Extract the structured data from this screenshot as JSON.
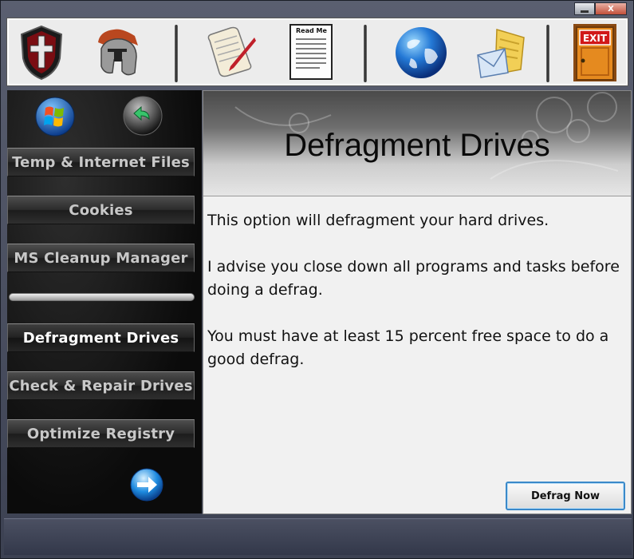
{
  "window": {
    "caption_buttons": {
      "minimize": "",
      "close": "X"
    }
  },
  "toolbar": {
    "icons": [
      {
        "name": "shield-cross-icon"
      },
      {
        "name": "spartan-helmet-icon"
      },
      {
        "name": "scroll-quill-icon"
      },
      {
        "name": "readme-document-icon",
        "label": "Read Me"
      },
      {
        "name": "globe-icon"
      },
      {
        "name": "mail-envelope-icon"
      },
      {
        "name": "exit-door-icon",
        "label": "EXIT"
      }
    ]
  },
  "sidebar": {
    "nav": [
      {
        "label": "Temp & Internet Files",
        "active": false
      },
      {
        "label": "Cookies",
        "active": false
      },
      {
        "label": "MS Cleanup Manager",
        "active": false
      },
      {
        "label": "Defragment Drives",
        "active": true
      },
      {
        "label": "Check & Repair Drives",
        "active": false
      },
      {
        "label": "Optimize Registry",
        "active": false
      }
    ]
  },
  "main": {
    "title": "Defragment Drives",
    "paragraphs": [
      "This option will defragment your hard drives.",
      "I advise you close down all programs and tasks before doing a defrag.",
      "You must have at least 15 percent free space to do a good defrag."
    ],
    "action_button": "Defrag Now"
  },
  "colors": {
    "accent_button_border": "#3a89c9",
    "sidebar_bg": "#0b0b0b",
    "panel_bg": "#f1f1f1"
  }
}
